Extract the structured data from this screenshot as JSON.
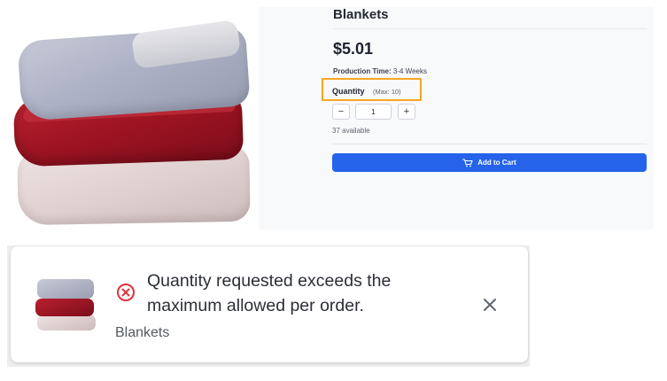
{
  "product": {
    "title": "Blankets",
    "price": "$5.01",
    "production_label": "Production Time:",
    "production_value": "3-4 Weeks",
    "quantity_label": "Quantity",
    "quantity_max": "(Max: 10)",
    "quantity_value": "1",
    "decrement_label": "−",
    "increment_label": "+",
    "available": "37 available",
    "add_to_cart_label": "Add to Cart",
    "cart_icon": "cart-icon",
    "accent_color": "#2563eb",
    "highlight_color": "#f5a623"
  },
  "toast": {
    "message": "Quantity requested exceeds the maximum allowed per order.",
    "product_name": "Blankets",
    "status_icon": "error-circle-x-icon",
    "error_color": "#e0313c",
    "close_icon": "close-icon"
  }
}
